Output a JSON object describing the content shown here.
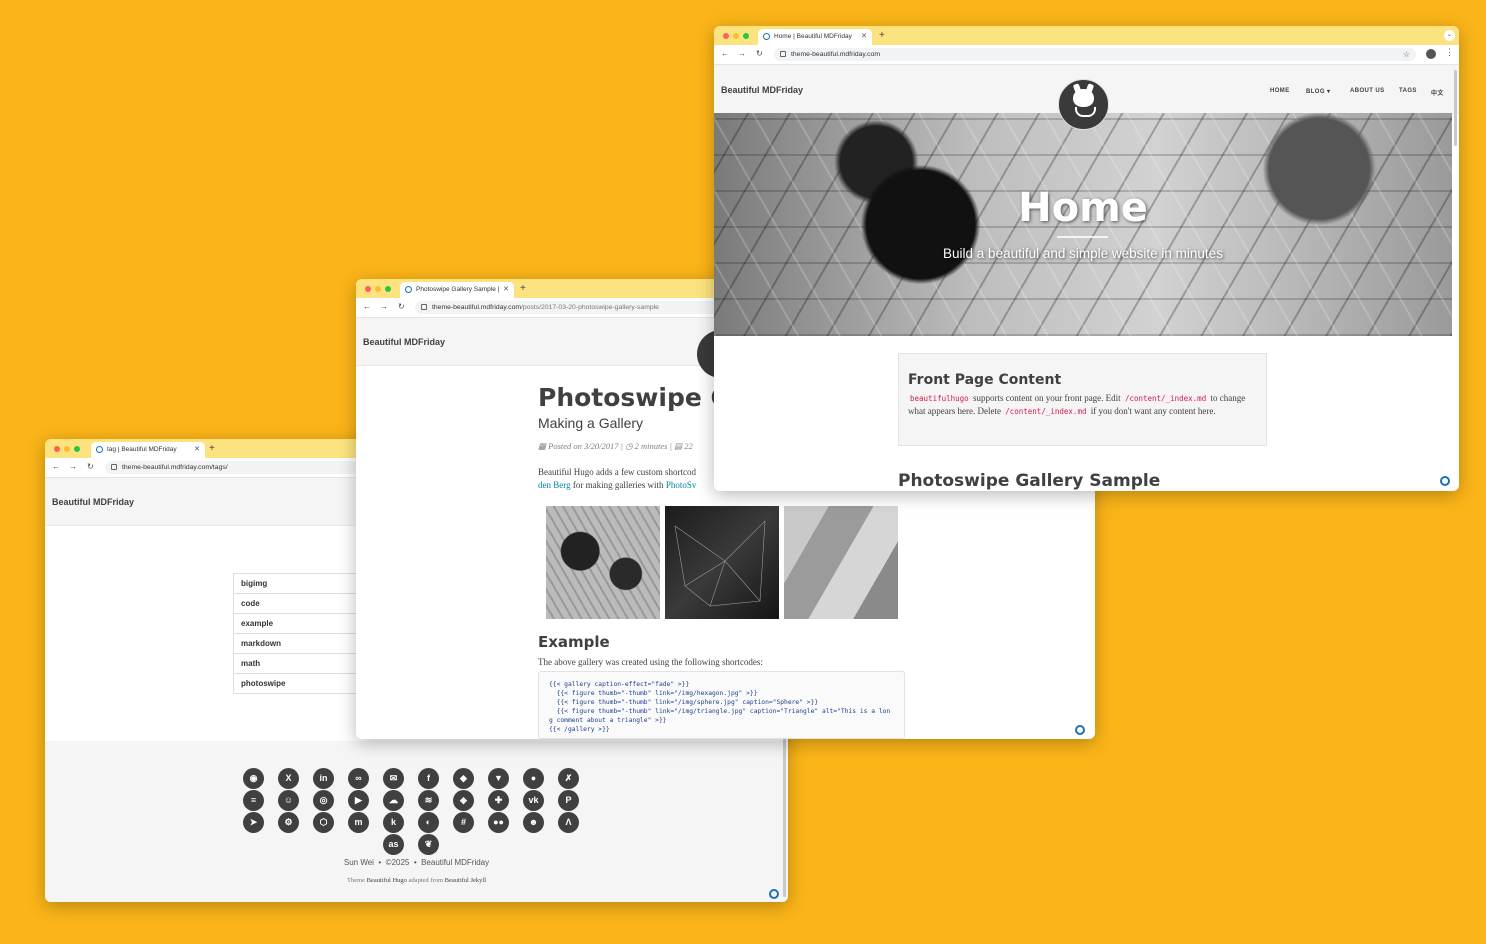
{
  "tag_window": {
    "tab_title": "tag | Beautiful MDFriday",
    "url": "theme-beautiful.mdfriday.com/tags/",
    "brand": "Beautiful MDFriday",
    "tags": [
      "bigimg",
      "code",
      "example",
      "markdown",
      "math",
      "photoswipe"
    ],
    "social_icons": [
      "github-icon",
      "x-icon",
      "linkedin-icon",
      "link-icon",
      "email-icon",
      "facebook-icon",
      "gitlab-icon",
      "bitbucket-icon",
      "reddit-icon",
      "xing-icon",
      "stackoverflow-icon",
      "snapchat-icon",
      "instagram-icon",
      "youtube-icon",
      "soundcloud-icon",
      "spotify-icon",
      "compass-icon",
      "gamepad-icon",
      "vk-icon",
      "paypal-icon",
      "telegram-icon",
      "steam-icon",
      "codepen-icon",
      "mastodon-icon",
      "kaggle-icon",
      "weibo-icon",
      "slack-icon",
      "medium-icon",
      "discord-icon",
      "strava-icon",
      "lastfm-icon",
      "bluesky-icon"
    ],
    "footer": {
      "author": "Sun Wei",
      "sep": "•",
      "year": "©2025",
      "site": "Beautiful MDFriday",
      "theme_prefix": "Theme",
      "theme_name": "Beautiful Hugo",
      "adapted": "adapted from",
      "origin": "Beautiful Jekyll"
    }
  },
  "post_window": {
    "tab_title": "Photoswipe Gallery Sample |",
    "url_host": "theme-beautiful.mdfriday.com",
    "url_path": "/posts/2017-03-20-photoswipe-gallery-sample",
    "brand": "Beautiful MDFriday",
    "title": "Photoswipe Ga",
    "subtitle": "Making a Gallery",
    "meta_posted": "Posted on 3/20/2017 |",
    "meta_read": "2 minutes |",
    "meta_words": "22",
    "intro_1": "Beautiful Hugo adds a few custom shortcod",
    "intro_link1": "den Berg",
    "intro_2": " for making galleries with ",
    "intro_link2": "PhotoSv",
    "section_heading": "Example",
    "section_text": "The above gallery was created using the following shortcodes:",
    "code_lines": [
      "{{< gallery caption-effect=\"fade\" >}}",
      "  {{< figure thumb=\"-thumb\" link=\"/img/hexagon.jpg\" >}}",
      "  {{< figure thumb=\"-thumb\" link=\"/img/sphere.jpg\" caption=\"Sphere\" >}}",
      "  {{< figure thumb=\"-thumb\" link=\"/img/triangle.jpg\" caption=\"Triangle\" alt=\"This is a lon",
      "g comment about a triangle\" >}}",
      "{{< /gallery >}}"
    ]
  },
  "home_window": {
    "tab_title": "Home | Beautiful MDFriday",
    "url": "theme-beautiful.mdfriday.com",
    "brand": "Beautiful MDFriday",
    "menu": [
      "HOME",
      "BLOG ▾",
      "ABOUT US",
      "TAGS",
      "中文"
    ],
    "hero_title": "Home",
    "hero_subtitle": "Build a beautiful and simple website in minutes",
    "fpc_title": "Front Page Content",
    "fpc_code1": "beautifulhugo",
    "fpc_t1": " supports content on your front page. Edit ",
    "fpc_code2": "/content/_index.md",
    "fpc_t2": " to change what appears here. Delete ",
    "fpc_code3": "/content/_index.md",
    "fpc_t3": " if you don't want any content here.",
    "next_heading": "Photoswipe Gallery Sample"
  },
  "colors": {
    "background": "#fbb518",
    "tabbar": "#fde37f",
    "brand_blue": "#1e6fb8"
  }
}
